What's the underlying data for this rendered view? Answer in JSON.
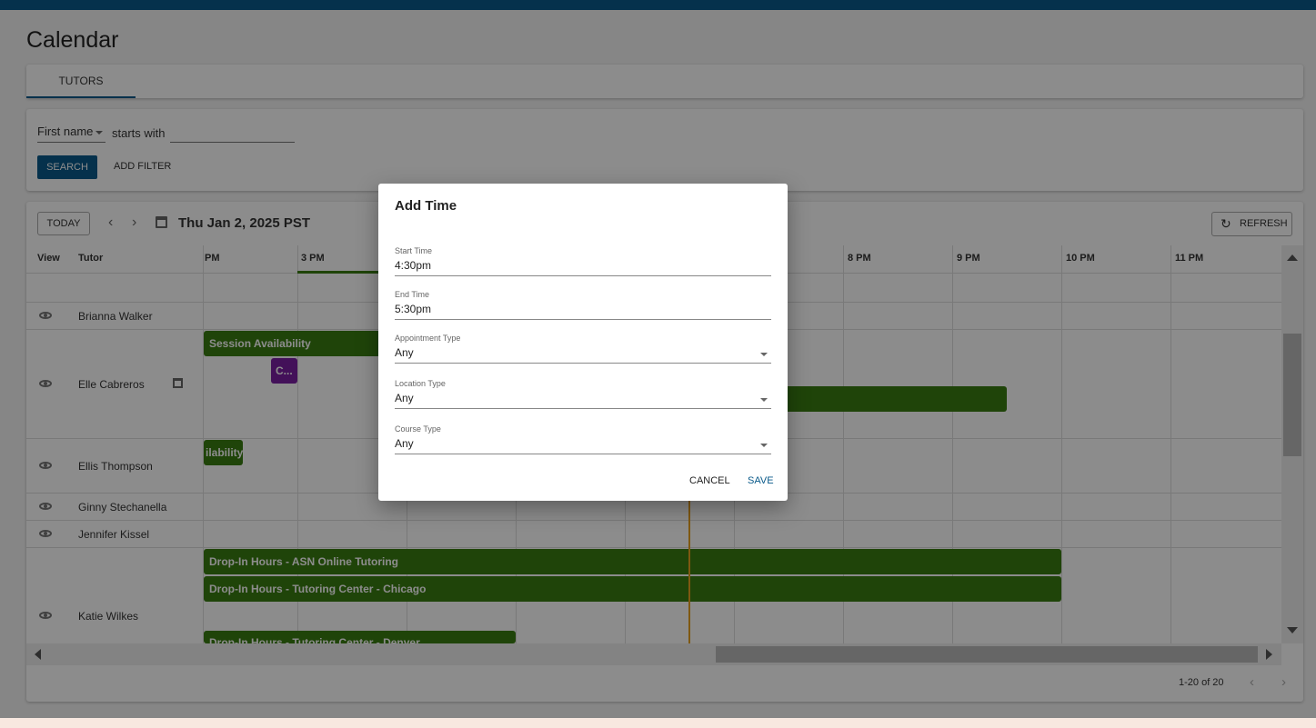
{
  "page": {
    "title": "Calendar"
  },
  "tabs": [
    {
      "label": "TUTORS"
    }
  ],
  "filter": {
    "field": "First name",
    "operator": "starts with",
    "value": "",
    "search_label": "SEARCH",
    "add_filter_label": "ADD FILTER"
  },
  "calendar": {
    "today_label": "TODAY",
    "prev_icon": "‹",
    "next_icon": "›",
    "date": "Thu Jan 2, 2025 PST",
    "refresh_label": "REFRESH",
    "refresh_icon": "↻",
    "columns": {
      "view": "View",
      "tutor": "Tutor"
    },
    "hours": [
      "PM",
      "3 PM",
      "8 PM",
      "9 PM",
      "10 PM",
      "11 PM"
    ],
    "rows": [
      {
        "name": "Brianna Walker"
      },
      {
        "name": "Elle Cabreros"
      },
      {
        "name": "Ellis Thompson"
      },
      {
        "name": "Ginny Stechanella"
      },
      {
        "name": "Jennifer Kissel"
      },
      {
        "name": "Katie Wilkes"
      }
    ],
    "events": {
      "elle_session": "Session Availability",
      "elle_purple": "C...",
      "ellis_avail": "ilability",
      "katie_1": "Drop-In Hours - ASN Online Tutoring",
      "katie_2": "Drop-In Hours - Tutoring Center - Chicago",
      "katie_3": "Drop-In Hours - Tutoring Center - Denver"
    },
    "pager": "1-20 of 20",
    "pager_prev": "‹",
    "pager_next": "›",
    "colors": {
      "event_green": "#3a7c12",
      "event_purple": "#7b1fa2",
      "now_line": "#e8a020",
      "brand": "#0a5a8a"
    }
  },
  "dialog": {
    "title": "Add Time",
    "fields": [
      {
        "label": "Start Time",
        "value": "4:30pm"
      },
      {
        "label": "End Time",
        "value": "5:30pm"
      },
      {
        "label": "Appointment Type",
        "value": "Any"
      },
      {
        "label": "Location Type",
        "value": "Any"
      },
      {
        "label": "Course Type",
        "value": "Any"
      }
    ],
    "cancel_label": "CANCEL",
    "save_label": "SAVE"
  }
}
